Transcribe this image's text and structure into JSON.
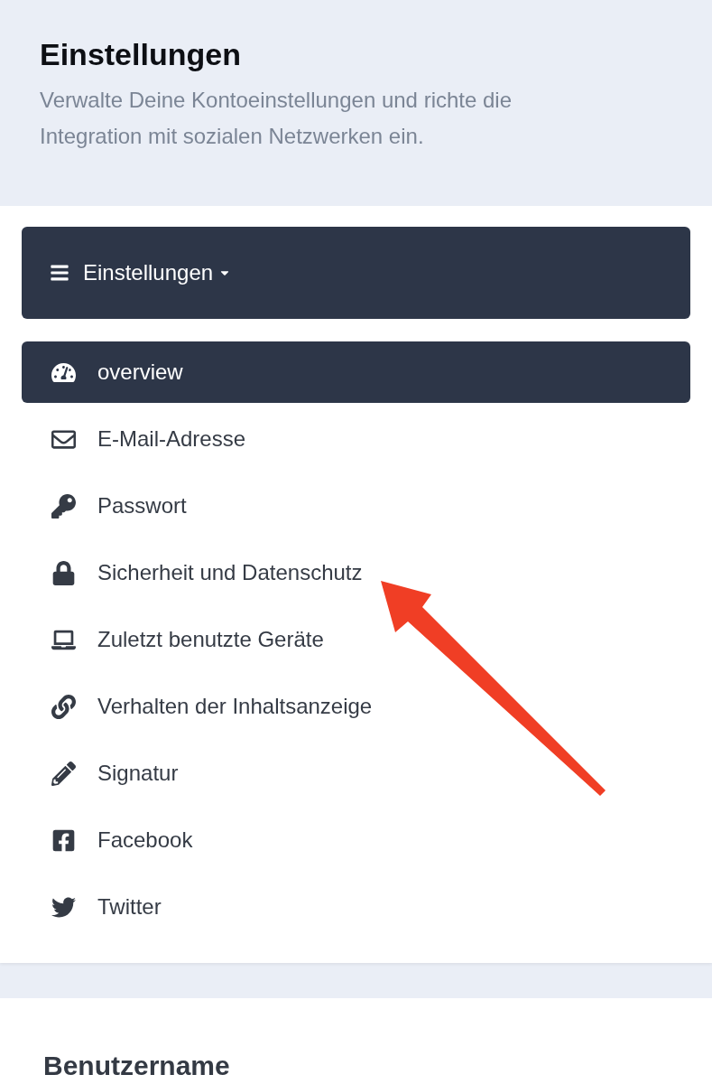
{
  "header": {
    "title": "Einstellungen",
    "subtitle": "Verwalte Deine Kontoeinstellungen und richte die Integration mit sozialen Netzwerken ein."
  },
  "settings_menu": {
    "toggle_label": "Einstellungen",
    "items": [
      {
        "label": "overview",
        "selected": true
      },
      {
        "label": "E-Mail-Adresse",
        "selected": false
      },
      {
        "label": "Passwort",
        "selected": false
      },
      {
        "label": "Sicherheit und Datenschutz",
        "selected": false
      },
      {
        "label": "Zuletzt benutzte Geräte",
        "selected": false
      },
      {
        "label": "Verhalten der Inhaltsanzeige",
        "selected": false
      },
      {
        "label": "Signatur",
        "selected": false
      },
      {
        "label": "Facebook",
        "selected": false
      },
      {
        "label": "Twitter",
        "selected": false
      }
    ]
  },
  "username_section": {
    "title": "Benutzername"
  }
}
